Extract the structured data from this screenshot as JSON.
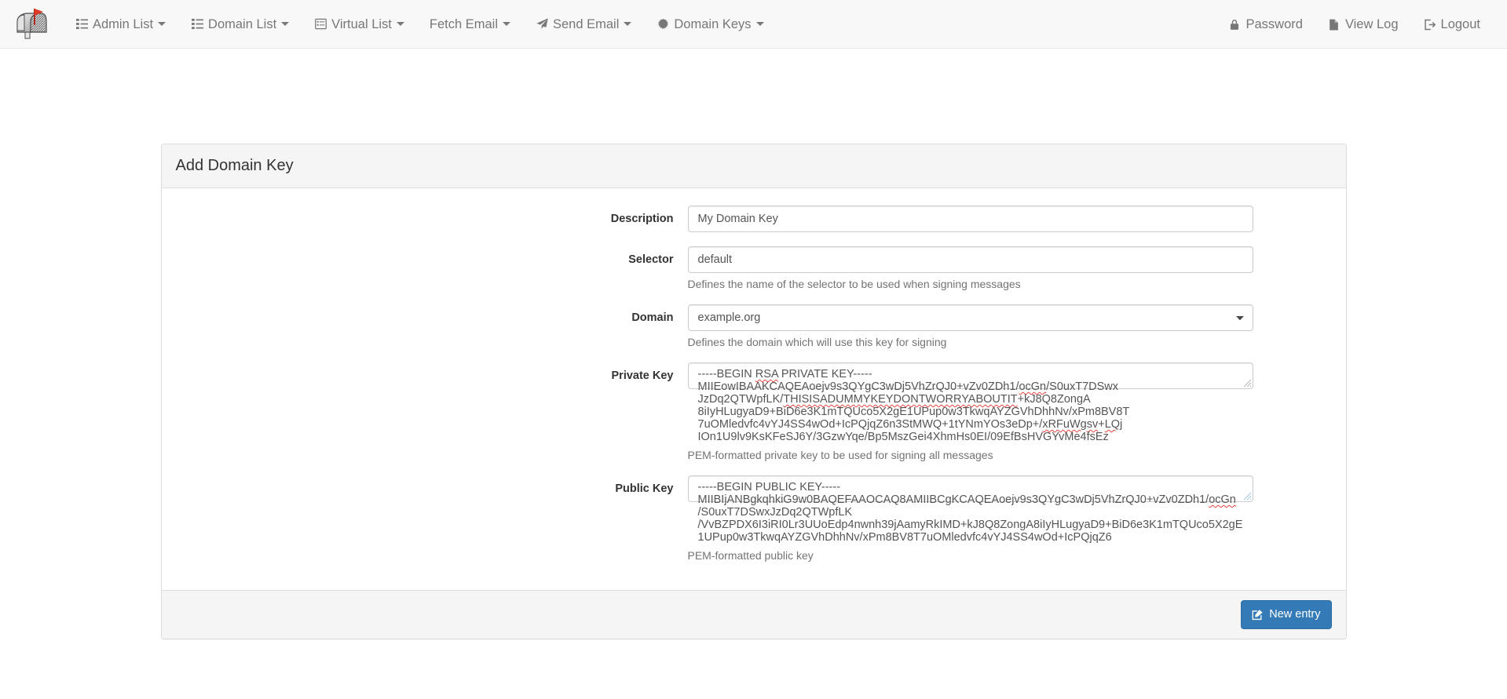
{
  "app": {
    "logo_name": "mailbox-logo",
    "accent_color": "#337ab7",
    "nav_text_color": "#777777"
  },
  "navbar": {
    "left_items": [
      {
        "label": "Admin List",
        "icon": "list-icon",
        "caret": true
      },
      {
        "label": "Domain List",
        "icon": "list-icon",
        "caret": true
      },
      {
        "label": "Virtual List",
        "icon": "list-alt-icon",
        "caret": true
      },
      {
        "label": "Fetch Email",
        "icon": "none",
        "caret": true
      },
      {
        "label": "Send Email",
        "icon": "paper-plane-icon",
        "caret": true
      },
      {
        "label": "Domain Keys",
        "icon": "gear-icon",
        "caret": true
      }
    ],
    "right_items": [
      {
        "label": "Password",
        "icon": "lock-icon"
      },
      {
        "label": "View Log",
        "icon": "file-icon"
      },
      {
        "label": "Logout",
        "icon": "sign-out-icon"
      }
    ]
  },
  "panel": {
    "title": "Add Domain Key"
  },
  "form": {
    "description": {
      "label": "Description",
      "value": "My Domain Key",
      "help": ""
    },
    "selector": {
      "label": "Selector",
      "value": "default",
      "help": "Defines the name of the selector to be used when signing messages"
    },
    "domain": {
      "label": "Domain",
      "value": "example.org",
      "options": [
        "example.org"
      ],
      "help": "Defines the domain which will use this key for signing"
    },
    "private_key": {
      "label": "Private Key",
      "help": "PEM-formatted private key to be used for signing all messages",
      "lines": [
        "-----BEGIN RSA PRIVATE KEY-----",
        "MIIEowIBAAKCAQEAoejv9s3QYgC3wDj5VhZrQJ0+vZv0ZDh1/ocGn/S0uxT7DSwx",
        "JzDq2QTWpfLK/THISISADUMMYKEYDONTWORRYABOUTIT+kJ8Q8ZongA",
        "8iIyHLugyaD9+BiD6e3K1mTQUco5X2gE1UPup0w3TkwqAYZGVhDhhNv/xPm8BV8T",
        "7uOMledvfc4vYJ4SS4wOd+IcPQjqZ6n3StMWQ+1tYNmYOs3eDp+/xRFuWgsv+LQj",
        "IOn1U9lv9KsKFeSJ6Y/3GzwYqe/Bp5MszGei4XhmHs0EI/09EfBsHVGYvMe4fsEz"
      ]
    },
    "public_key": {
      "label": "Public Key",
      "help": "PEM-formatted public key",
      "focused": true,
      "lines": [
        "-----BEGIN PUBLIC KEY-----",
        "MIIBIjANBgkqhkiG9w0BAQEFAAOCAQ8AMIIBCgKCAQEAoejv9s3QYgC3wDj5VhZrQJ0+vZv0ZDh1/ocGn",
        "/S0uxT7DSwxJzDq2QTWpfLK",
        "/VvBZPDX6I3iRI0Lr3UUoEdp4nwnh39jAamyRkIMD+kJ8Q8ZongA8iIyHLugyaD9+BiD6e3K1mTQUco5X2gE",
        "1UPup0w3TkwqAYZGVhDhhNv/xPm8BV8T7uOMledvfc4vYJ4SS4wOd+IcPQjqZ6"
      ]
    }
  },
  "footer": {
    "new_entry_label": "New entry",
    "new_entry_icon": "pencil-square-icon"
  }
}
